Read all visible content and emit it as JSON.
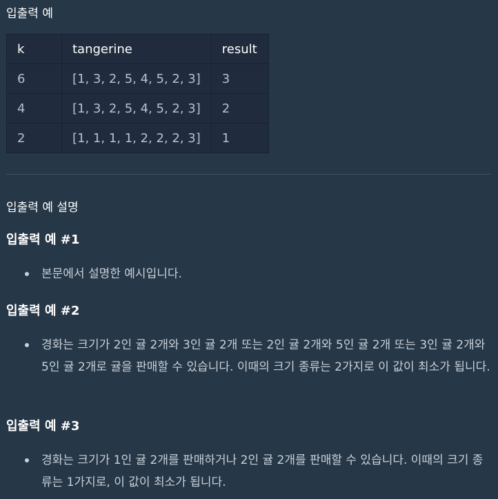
{
  "section_title": "입출력 예",
  "table": {
    "headers": [
      "k",
      "tangerine",
      "result"
    ],
    "rows": [
      [
        "6",
        "[1, 3, 2, 5, 4, 5, 2, 3]",
        "3"
      ],
      [
        "4",
        "[1, 3, 2, 5, 4, 5, 2, 3]",
        "2"
      ],
      [
        "2",
        "[1, 1, 1, 1, 2, 2, 2, 3]",
        "1"
      ]
    ]
  },
  "description_title": "입출력 예 설명",
  "cases": [
    {
      "title": "입출력 예 #1",
      "text": "본문에서 설명한 예시입니다."
    },
    {
      "title": "입출력 예 #2",
      "text": "경화는 크기가 2인 귤 2개와 3인 귤 2개 또는 2인 귤 2개와 5인 귤 2개 또는 3인 귤 2개와 5인 귤 2개로 귤을 판매할 수 있습니다. 이때의 크기 종류는 2가지로 이 값이 최소가 됩니다."
    },
    {
      "title": "입출력 예 #3",
      "text": "경화는 크기가 1인 귤 2개를 판매하거나 2인 귤 2개를 판매할 수 있습니다. 이때의 크기 종류는 1가지로, 이 값이 최소가 됩니다."
    }
  ],
  "colors": {
    "background": "#263747",
    "table_cell": "#202b3d",
    "table_border": "#172334",
    "heading": "#ffffff",
    "text": "#c9d1d9"
  }
}
